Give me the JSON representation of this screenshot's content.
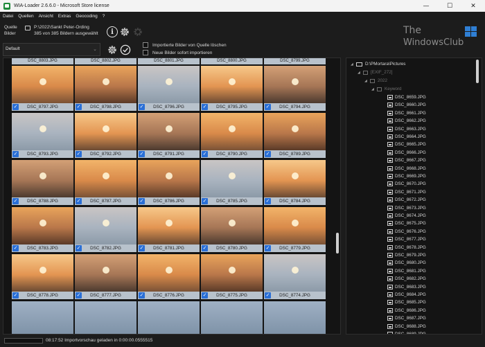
{
  "window": {
    "title": "WIA-Loader 2.6.6.0 - Microsoft Store license"
  },
  "window_buttons": {
    "minimize": "—",
    "maximize": "☐",
    "close": "✕"
  },
  "menu": [
    "Datei",
    "Quellen",
    "Ansicht",
    "Extras",
    "Geocoding",
    "?"
  ],
  "toolbar": {
    "source_label_line1": "Quelle",
    "source_label_line2": "Bilder",
    "source_path": "P:\\2022\\Sankt Peter-Ording",
    "source_count": "385 von 385 Bildern ausgewählt",
    "info_icon": "i",
    "profile_value": "Default",
    "opt_delete": "Importierte Bilder von Quelle löschen",
    "opt_import": "Neue Bilder sofort importieren"
  },
  "logo": {
    "line1": "The",
    "line2": "WindowsClub"
  },
  "grid": {
    "top_partial": [
      "DSC_8803.JPG",
      "DSC_8802.JPG",
      "DSC_8801.JPG",
      "DSC_8800.JPG",
      "DSC_8799.JPG"
    ],
    "rows": [
      [
        "DSC_8797.JPG",
        "DSC_8798.JPG",
        "DSC_8796.JPG",
        "DSC_8795.JPG",
        "DSC_8794.JPG"
      ],
      [
        "DSC_8793.JPG",
        "DSC_8792.JPG",
        "DSC_8791.JPG",
        "DSC_8790.JPG",
        "DSC_8789.JPG"
      ],
      [
        "DSC_8788.JPG",
        "DSC_8787.JPG",
        "DSC_8786.JPG",
        "DSC_8785.JPG",
        "DSC_8784.JPG"
      ],
      [
        "DSC_8783.JPG",
        "DSC_8782.JPG",
        "DSC_8781.JPG",
        "DSC_8780.JPG",
        "DSC_8779.JPG"
      ],
      [
        "DSC_8778.JPG",
        "DSC_8777.JPG",
        "DSC_8776.JPG",
        "DSC_8775.JPG",
        "DSC_8774.JPG"
      ]
    ]
  },
  "tree": {
    "root": "D:\\PMortara\\Pictures",
    "exif": "[EXIF_272]",
    "year": "2022",
    "keyword": "Keyword",
    "files": [
      "DSC_8659.JPG",
      "DSC_8660.JPG",
      "DSC_8661.JPG",
      "DSC_8662.JPG",
      "DSC_8663.JPG",
      "DSC_8664.JPG",
      "DSC_8665.JPG",
      "DSC_8666.JPG",
      "DSC_8667.JPG",
      "DSC_8668.JPG",
      "DSC_8669.JPG",
      "DSC_8670.JPG",
      "DSC_8671.JPG",
      "DSC_8672.JPG",
      "DSC_8673.JPG",
      "DSC_8674.JPG",
      "DSC_8675.JPG",
      "DSC_8676.JPG",
      "DSC_8677.JPG",
      "DSC_8678.JPG",
      "DSC_8679.JPG",
      "DSC_8680.JPG",
      "DSC_8681.JPG",
      "DSC_8682.JPG",
      "DSC_8683.JPG",
      "DSC_8684.JPG",
      "DSC_8685.JPG",
      "DSC_8686.JPG",
      "DSC_8687.JPG",
      "DSC_8688.JPG",
      "DSC_8689.JPG"
    ]
  },
  "status": {
    "text": "08:17:52 Importvorschau geladen in 0:00:00.0555515"
  },
  "colors": {
    "accent": "#2a6fd6",
    "caption_bg": "#b8c2cc",
    "background": "#1c1c1c"
  }
}
